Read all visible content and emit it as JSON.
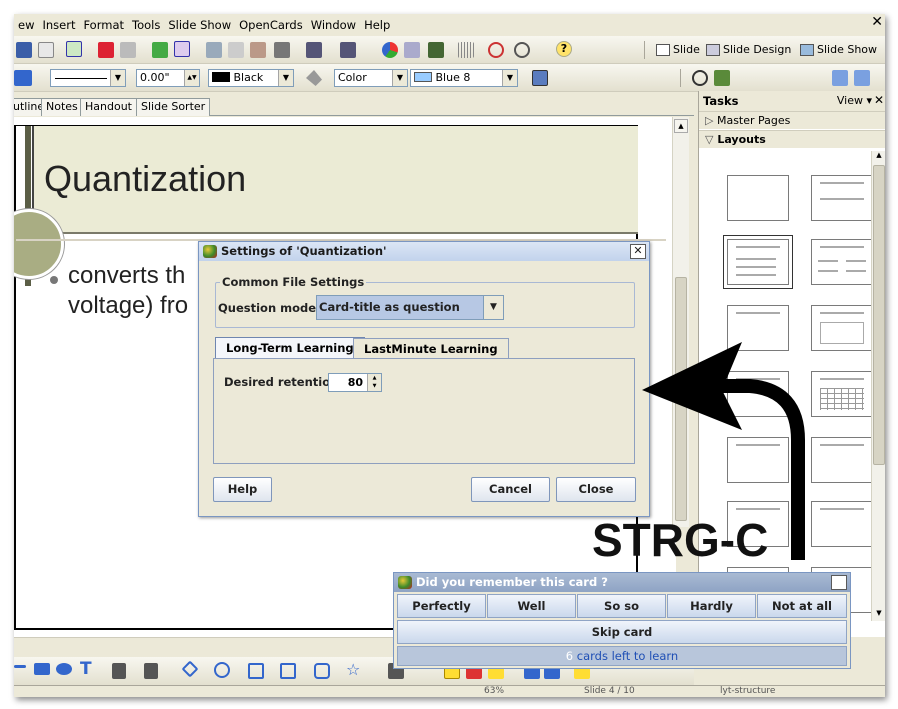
{
  "menu": {
    "items": [
      "ew",
      "Insert",
      "Format",
      "Tools",
      "Slide Show",
      "OpenCards",
      "Window",
      "Help"
    ]
  },
  "toolbar": {
    "slide_btn": "Slide",
    "slide_design_btn": "Slide Design",
    "slide_show_btn": "Slide Show"
  },
  "formatbar": {
    "line_width": "0.00\"",
    "line_color": "Black",
    "area_style": "Color",
    "area_color": "Blue 8"
  },
  "view_tabs": [
    "utline",
    "Notes",
    "Handout",
    "Slide Sorter"
  ],
  "slide": {
    "title": "Quantization",
    "bullet_line1": "converts th",
    "bullet_line2": "voltage) fro"
  },
  "tasks": {
    "title": "Tasks",
    "view_label": "View",
    "master_pages": "Master Pages",
    "layouts": "Layouts"
  },
  "settings_dialog": {
    "title": "Settings of 'Quantization'",
    "group_label": "Common File Settings",
    "mode_label": "Question mode :",
    "mode_value": "Card-title as question",
    "tab_long": "Long-Term Learning",
    "tab_last": "LastMinute Learning",
    "retention_label": "Desired retention",
    "retention_value": "80",
    "help": "Help",
    "cancel": "Cancel",
    "close": "Close"
  },
  "review_dialog": {
    "title": "Did you remember this card ?",
    "answers": [
      "Perfectly",
      "Well",
      "So so",
      "Hardly",
      "Not at all"
    ],
    "skip": "Skip card",
    "count": "6",
    "remaining_text": "cards left to learn"
  },
  "annotation": {
    "text": "STRG-C"
  },
  "colors": {
    "line_color": "#000000",
    "area_color": "#99ccff",
    "accent": "#3a6ea5"
  },
  "status": {
    "zoom": "63%",
    "slide_pos": "Slide 4 / 10",
    "layout": "lyt-structure"
  }
}
